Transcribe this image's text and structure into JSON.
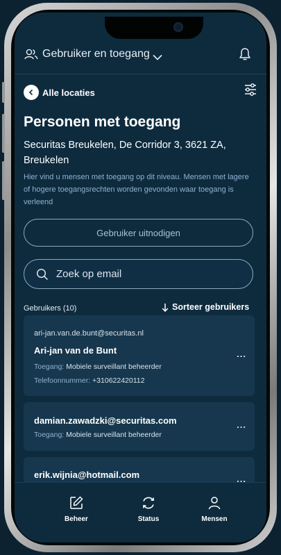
{
  "header": {
    "title": "Gebruiker en toegang"
  },
  "nav": {
    "back_label": "Alle locaties"
  },
  "page": {
    "title": "Personen met toegang",
    "location": "Securitas Breukelen, De Corridor 3, 3621 ZA, Breukelen",
    "description": "Hier vind u mensen met toegang op dit niveau. Mensen met lagere of hogere toegangsrechten worden gevonden waar toegang is verleend"
  },
  "actions": {
    "invite_label": "Gebruiker uitnodigen"
  },
  "search": {
    "placeholder": "Zoek op email"
  },
  "users": {
    "count_label": "Gebruikers (10)",
    "sort_label": "Sorteer gebruikers",
    "list": [
      {
        "email": "ari-jan.van.de.bunt@securitas.nl",
        "name": "Ari-jan van de Bunt",
        "access_key": "Toegang:",
        "access_value": "Mobiele surveillant beheerder",
        "phone_key": "Telefoonnummer:",
        "phone_value": "+310622420112",
        "more": "..."
      },
      {
        "email": "damian.zawadzki@securitas.com",
        "access_key": "Toegang:",
        "access_value": "Mobiele surveillant beheerder",
        "more": "..."
      },
      {
        "email": "erik.wijnia@hotmail.com",
        "more": "..."
      }
    ]
  },
  "bottom_nav": {
    "items": [
      {
        "label": "Beheer",
        "icon": "edit-icon"
      },
      {
        "label": "Status",
        "icon": "refresh-icon"
      },
      {
        "label": "Mensen",
        "icon": "person-icon"
      }
    ]
  },
  "colors": {
    "background": "#0e2b3e",
    "card": "#16374d",
    "accent_text": "#8fb2d0",
    "outline": "#8fa7bd"
  }
}
